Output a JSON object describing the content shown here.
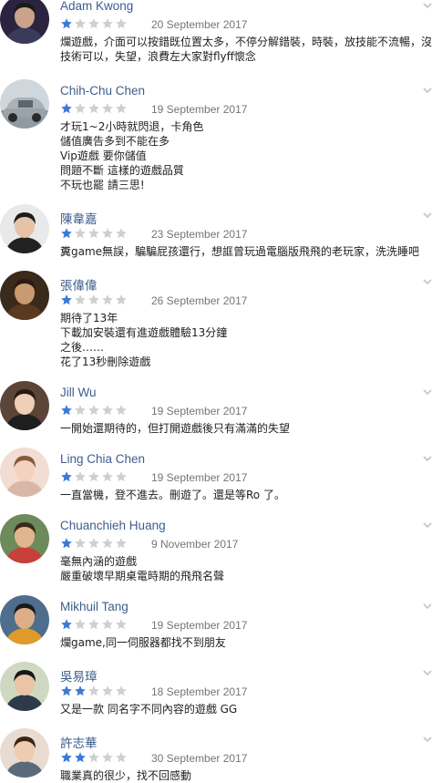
{
  "colors": {
    "star_filled": "#3b79d6",
    "star_empty": "#cfcfcf",
    "name": "#3e5d8c",
    "date": "#757575"
  },
  "reviews": [
    {
      "name": "Adam Kwong",
      "date": "20 September 2017",
      "rating": 1,
      "avatar": "avatar-icon",
      "lines": [
        "爛遊戲，介面可以按錯既位置太多，不停分解錯裝，時裝，放技能不流暢，沒",
        "技術可以，失望，浪費左大家對flyff懷念"
      ]
    },
    {
      "name": "Chih-Chu Chen",
      "date": "19 September 2017",
      "rating": 1,
      "avatar": "avatar-icon",
      "lines": [
        "才玩1~2小時就閃退，卡角色",
        "儲值廣告多到不能在多",
        "Vip遊戲 要你儲值",
        "問題不斷 這樣的遊戲品質",
        "不玩也罷 請三思!"
      ]
    },
    {
      "name": "陳韋嘉",
      "date": "23 September 2017",
      "rating": 1,
      "avatar": "avatar-icon",
      "lines": [
        "糞game無誤，騙騙屁孩還行，想誆曾玩過電腦版飛飛的老玩家，洗洗睡吧"
      ]
    },
    {
      "name": "張偉偉",
      "date": "26 September 2017",
      "rating": 1,
      "avatar": "avatar-icon",
      "lines": [
        "期待了13年",
        "下載加安裝還有進遊戲體驗13分鐘",
        "之後……",
        "花了13秒刪除遊戲"
      ]
    },
    {
      "name": "Jill Wu",
      "date": "19 September 2017",
      "rating": 1,
      "avatar": "avatar-icon",
      "lines": [
        "一開始還期待的，但打開遊戲後只有滿滿的失望"
      ]
    },
    {
      "name": "Ling Chia Chen",
      "date": "19 September 2017",
      "rating": 1,
      "avatar": "avatar-icon",
      "lines": [
        "一直當機，登不進去。刪遊了。還是等Ro 了。"
      ]
    },
    {
      "name": "Chuanchieh Huang",
      "date": "9 November 2017",
      "rating": 1,
      "avatar": "avatar-icon",
      "lines": [
        "毫無內涵的遊戲",
        "嚴重破壞早期桌電時期的飛飛名聲"
      ]
    },
    {
      "name": "Mikhuil Tang",
      "date": "19 September 2017",
      "rating": 1,
      "avatar": "avatar-icon",
      "lines": [
        "爛game,同一伺服器都找不到朋友"
      ]
    },
    {
      "name": "吳易璋",
      "date": "18 September 2017",
      "rating": 2,
      "avatar": "avatar-icon",
      "lines": [
        "又是一款 同名字不同內容的遊戲 GG"
      ]
    },
    {
      "name": "許志華",
      "date": "30 September 2017",
      "rating": 2,
      "avatar": "avatar-icon",
      "lines": [
        "職業真的很少，找不回感動"
      ]
    }
  ]
}
